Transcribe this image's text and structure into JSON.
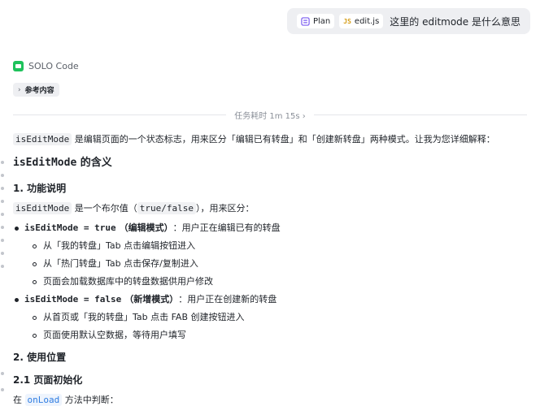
{
  "user_message": {
    "chips": [
      {
        "icon": "plan-icon",
        "label": "Plan"
      },
      {
        "icon": "js-file-icon",
        "glyph": "JS",
        "label": "edit.js"
      }
    ],
    "text": "这里的 editmode 是什么意思"
  },
  "assistant": {
    "name": "SOLO Code",
    "reference_label": "参考内容",
    "timer": "任务耗时 1m 15s"
  },
  "answer": {
    "intro_code": "isEditMode",
    "intro_text": " 是编辑页面的一个状态标志，用来区分「编辑已有转盘」和「创建新转盘」两种模式。让我为您详细解释：",
    "heading_code": "isEditMode",
    "heading_text": " 的含义",
    "section1": "1. 功能说明",
    "s1_code": "isEditMode",
    "s1_text_a": " 是一个布尔值（",
    "s1_code_b": "true",
    "s1_slash": "/",
    "s1_code_c": "false",
    "s1_text_b": "），用来区分：",
    "bullet1_code": "isEditMode = true",
    "bullet1_bold": "（编辑模式）",
    "bullet1_text": "：用户正在编辑已有的转盘",
    "bullet1_subs": [
      "从「我的转盘」Tab 点击编辑按钮进入",
      "从「热门转盘」Tab 点击保存/复制进入",
      "页面会加载数据库中的转盘数据供用户修改"
    ],
    "bullet2_code": "isEditMode = false",
    "bullet2_bold": "（新增模式）",
    "bullet2_text": "：用户正在创建新的转盘",
    "bullet2_subs": [
      "从首页或「我的转盘」Tab 点击 FAB 创建按钮进入",
      "页面使用默认空数据，等待用户填写"
    ],
    "section2": "2. 使用位置",
    "section21": "2.1 页面初始化",
    "last_a": "在 ",
    "last_code": "onLoad",
    "last_b": " 方法中判断："
  }
}
